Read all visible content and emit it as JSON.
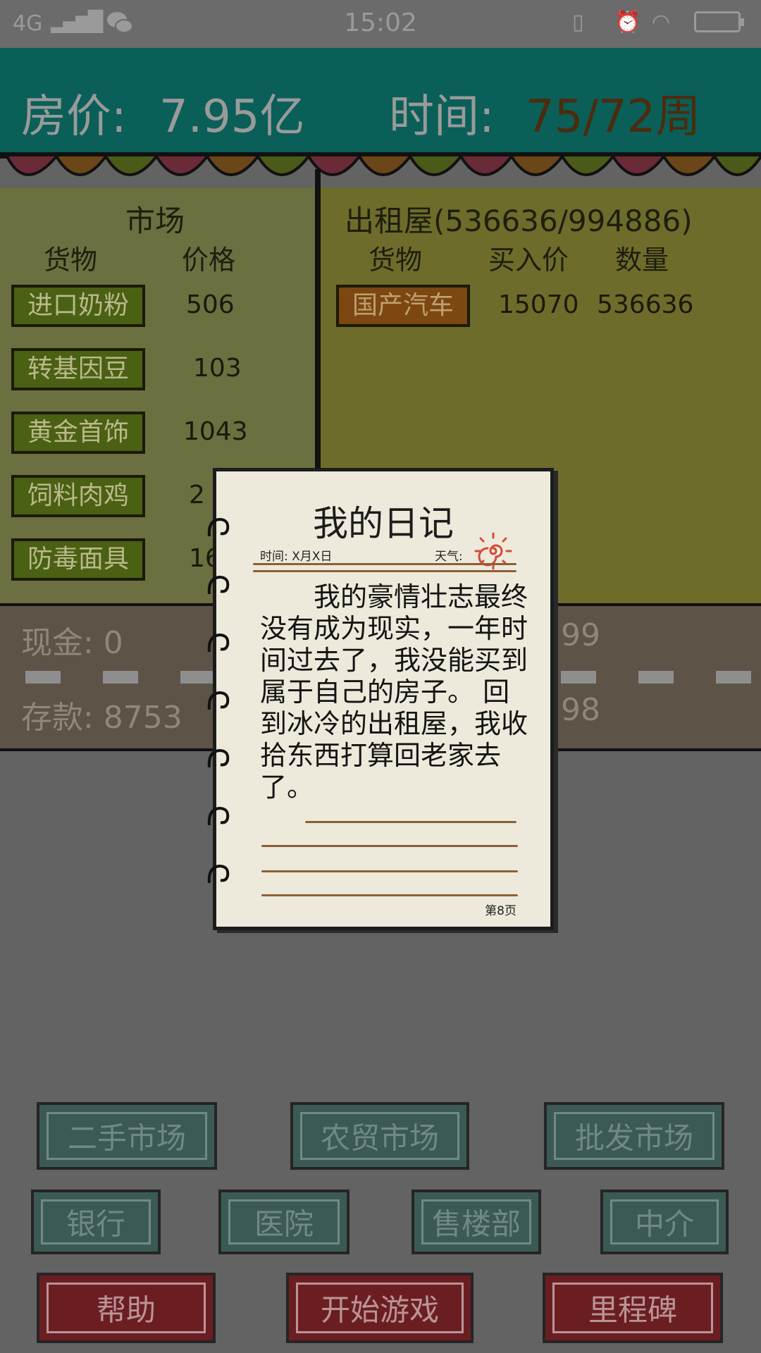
{
  "status_bar": {
    "network": "4G",
    "time": "15:02",
    "icons": [
      "signal-icon",
      "wechat-icon",
      "vibrate-icon",
      "alarm-icon",
      "wifi-icon",
      "battery-icon"
    ]
  },
  "header": {
    "price_label": "房价:",
    "price_value": "7.95亿",
    "time_label": "时间:",
    "time_value": "75/72周"
  },
  "market": {
    "title": "市场",
    "col_goods": "货物",
    "col_price": "价格",
    "items": [
      {
        "name": "进口奶粉",
        "price": "506"
      },
      {
        "name": "转基因豆",
        "price": "103"
      },
      {
        "name": "黄金首饰",
        "price": "1043"
      },
      {
        "name": "饲料肉鸡",
        "price": "2"
      },
      {
        "name": "防毒面具",
        "price": "16"
      }
    ]
  },
  "rental": {
    "title": "出租屋(536636/994886)",
    "col_goods": "货物",
    "col_buy_price": "买入价",
    "col_quantity": "数量",
    "items": [
      {
        "name": "国产汽车",
        "buy_price": "15070",
        "quantity": "536636"
      }
    ]
  },
  "money": {
    "cash": "现金: 0",
    "savings": "存款: 8753",
    "right_top": "99",
    "right_bottom": "98"
  },
  "diary": {
    "title": "我的日记",
    "time": "时间: X月X日",
    "weather": "天气:",
    "body": "我的豪情壮志最终没有成为现实，一年时间过去了，我没能买到属于自己的房子。 回到冰冷的出租屋，我收拾东西打算回老家去了。",
    "page": "第8页"
  },
  "buttons": {
    "row1": [
      "二手市场",
      "农贸市场",
      "批发市场"
    ],
    "row2": [
      "银行",
      "医院",
      "售楼部",
      "中介"
    ],
    "row3": [
      "帮助",
      "开始游戏",
      "里程碑"
    ]
  },
  "colors": {
    "header_bg": "#0a5f59",
    "market_bg": "#6c6f40",
    "rental_bg": "#6d6c2b",
    "goods_button": "#4a6012",
    "rental_goods_button": "#7c4710",
    "blue_button": "#3c5a55",
    "red_button": "#6b1e22",
    "diary_paper": "#eeeadb"
  }
}
